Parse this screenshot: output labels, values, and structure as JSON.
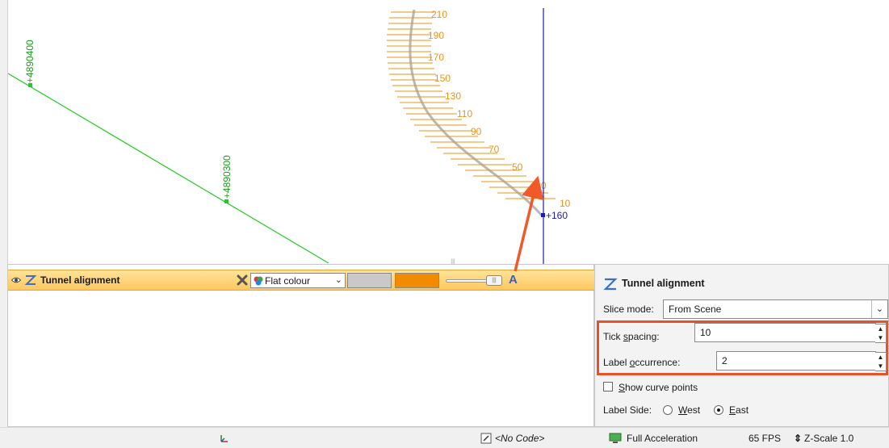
{
  "scene": {
    "northing_labels": [
      "+4890400",
      "+4890300"
    ],
    "tick_labels": [
      "210",
      "190",
      "170",
      "150",
      "130",
      "110",
      "90",
      "70",
      "50",
      "30",
      "10"
    ],
    "partial_tick_label": "0",
    "easting_label": "+160",
    "colors": {
      "northing_line": "#22cc22",
      "tick_orange": "#e8941a",
      "easting_line": "#1a1ab4",
      "alignment_curve": "#b8b8b8",
      "callout_arrow": "#f05a28"
    }
  },
  "list_panel": {
    "object_name": "Tunnel alignment",
    "colour_mode": "Flat colour",
    "swatch_colors": [
      "#c9c9c9",
      "#f38b00"
    ],
    "icons": [
      "eye-icon",
      "curve-icon",
      "remove-icon",
      "palette-icon",
      "label-toggle-icon"
    ]
  },
  "props": {
    "title": "Tunnel alignment",
    "slice_mode_label": "Slice mode:",
    "slice_mode_value": "From Scene",
    "tick_spacing_label_pre": "Tick ",
    "tick_spacing_label_u": "s",
    "tick_spacing_label_post": "pacing:",
    "tick_spacing_value": "10",
    "label_occurrence_label_pre": "Label ",
    "label_occurrence_label_u": "o",
    "label_occurrence_label_post": "ccurrence:",
    "label_occurrence_value": "2",
    "show_curve_points_u": "S",
    "show_curve_points_rest": "how curve points",
    "show_curve_points_checked": false,
    "label_side_label": "Label Side:",
    "west_u": "W",
    "west_rest": "est",
    "east_u": "E",
    "east_rest": "ast",
    "selected_side": "East"
  },
  "status_bar": {
    "no_code": "<No Code>",
    "acceleration": "Full Acceleration",
    "fps": "65 FPS",
    "zscale": "Z-Scale 1.0"
  }
}
